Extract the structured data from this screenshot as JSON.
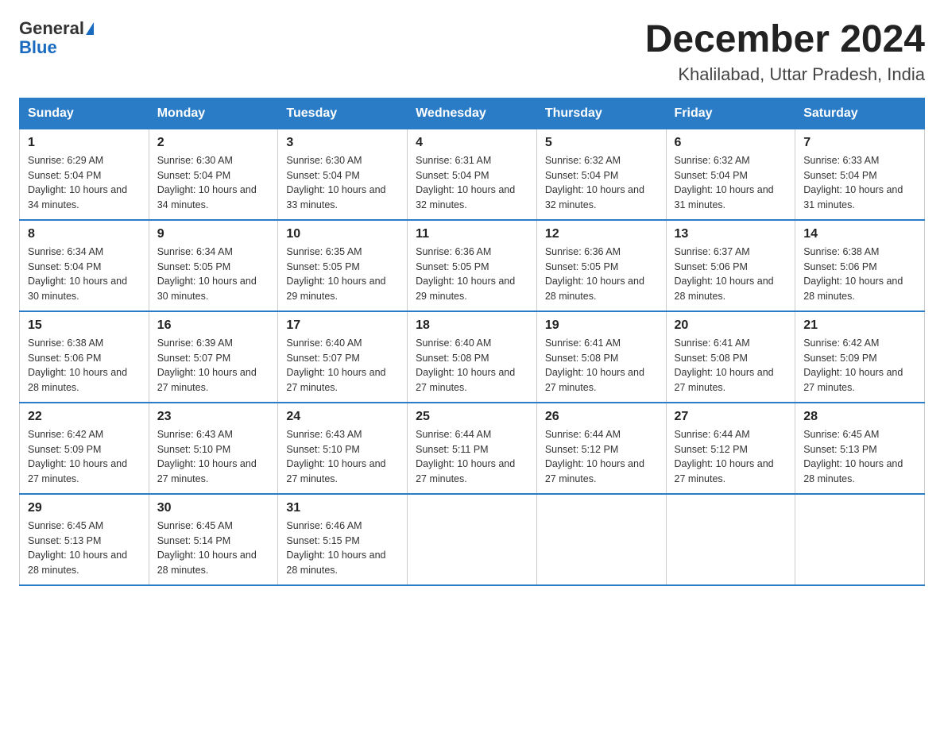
{
  "logo": {
    "general": "General",
    "blue": "Blue"
  },
  "title": "December 2024",
  "subtitle": "Khalilabad, Uttar Pradesh, India",
  "days_of_week": [
    "Sunday",
    "Monday",
    "Tuesday",
    "Wednesday",
    "Thursday",
    "Friday",
    "Saturday"
  ],
  "weeks": [
    [
      {
        "day": "1",
        "sunrise": "6:29 AM",
        "sunset": "5:04 PM",
        "daylight": "10 hours and 34 minutes."
      },
      {
        "day": "2",
        "sunrise": "6:30 AM",
        "sunset": "5:04 PM",
        "daylight": "10 hours and 34 minutes."
      },
      {
        "day": "3",
        "sunrise": "6:30 AM",
        "sunset": "5:04 PM",
        "daylight": "10 hours and 33 minutes."
      },
      {
        "day": "4",
        "sunrise": "6:31 AM",
        "sunset": "5:04 PM",
        "daylight": "10 hours and 32 minutes."
      },
      {
        "day": "5",
        "sunrise": "6:32 AM",
        "sunset": "5:04 PM",
        "daylight": "10 hours and 32 minutes."
      },
      {
        "day": "6",
        "sunrise": "6:32 AM",
        "sunset": "5:04 PM",
        "daylight": "10 hours and 31 minutes."
      },
      {
        "day": "7",
        "sunrise": "6:33 AM",
        "sunset": "5:04 PM",
        "daylight": "10 hours and 31 minutes."
      }
    ],
    [
      {
        "day": "8",
        "sunrise": "6:34 AM",
        "sunset": "5:04 PM",
        "daylight": "10 hours and 30 minutes."
      },
      {
        "day": "9",
        "sunrise": "6:34 AM",
        "sunset": "5:05 PM",
        "daylight": "10 hours and 30 minutes."
      },
      {
        "day": "10",
        "sunrise": "6:35 AM",
        "sunset": "5:05 PM",
        "daylight": "10 hours and 29 minutes."
      },
      {
        "day": "11",
        "sunrise": "6:36 AM",
        "sunset": "5:05 PM",
        "daylight": "10 hours and 29 minutes."
      },
      {
        "day": "12",
        "sunrise": "6:36 AM",
        "sunset": "5:05 PM",
        "daylight": "10 hours and 28 minutes."
      },
      {
        "day": "13",
        "sunrise": "6:37 AM",
        "sunset": "5:06 PM",
        "daylight": "10 hours and 28 minutes."
      },
      {
        "day": "14",
        "sunrise": "6:38 AM",
        "sunset": "5:06 PM",
        "daylight": "10 hours and 28 minutes."
      }
    ],
    [
      {
        "day": "15",
        "sunrise": "6:38 AM",
        "sunset": "5:06 PM",
        "daylight": "10 hours and 28 minutes."
      },
      {
        "day": "16",
        "sunrise": "6:39 AM",
        "sunset": "5:07 PM",
        "daylight": "10 hours and 27 minutes."
      },
      {
        "day": "17",
        "sunrise": "6:40 AM",
        "sunset": "5:07 PM",
        "daylight": "10 hours and 27 minutes."
      },
      {
        "day": "18",
        "sunrise": "6:40 AM",
        "sunset": "5:08 PM",
        "daylight": "10 hours and 27 minutes."
      },
      {
        "day": "19",
        "sunrise": "6:41 AM",
        "sunset": "5:08 PM",
        "daylight": "10 hours and 27 minutes."
      },
      {
        "day": "20",
        "sunrise": "6:41 AM",
        "sunset": "5:08 PM",
        "daylight": "10 hours and 27 minutes."
      },
      {
        "day": "21",
        "sunrise": "6:42 AM",
        "sunset": "5:09 PM",
        "daylight": "10 hours and 27 minutes."
      }
    ],
    [
      {
        "day": "22",
        "sunrise": "6:42 AM",
        "sunset": "5:09 PM",
        "daylight": "10 hours and 27 minutes."
      },
      {
        "day": "23",
        "sunrise": "6:43 AM",
        "sunset": "5:10 PM",
        "daylight": "10 hours and 27 minutes."
      },
      {
        "day": "24",
        "sunrise": "6:43 AM",
        "sunset": "5:10 PM",
        "daylight": "10 hours and 27 minutes."
      },
      {
        "day": "25",
        "sunrise": "6:44 AM",
        "sunset": "5:11 PM",
        "daylight": "10 hours and 27 minutes."
      },
      {
        "day": "26",
        "sunrise": "6:44 AM",
        "sunset": "5:12 PM",
        "daylight": "10 hours and 27 minutes."
      },
      {
        "day": "27",
        "sunrise": "6:44 AM",
        "sunset": "5:12 PM",
        "daylight": "10 hours and 27 minutes."
      },
      {
        "day": "28",
        "sunrise": "6:45 AM",
        "sunset": "5:13 PM",
        "daylight": "10 hours and 28 minutes."
      }
    ],
    [
      {
        "day": "29",
        "sunrise": "6:45 AM",
        "sunset": "5:13 PM",
        "daylight": "10 hours and 28 minutes."
      },
      {
        "day": "30",
        "sunrise": "6:45 AM",
        "sunset": "5:14 PM",
        "daylight": "10 hours and 28 minutes."
      },
      {
        "day": "31",
        "sunrise": "6:46 AM",
        "sunset": "5:15 PM",
        "daylight": "10 hours and 28 minutes."
      },
      null,
      null,
      null,
      null
    ]
  ]
}
